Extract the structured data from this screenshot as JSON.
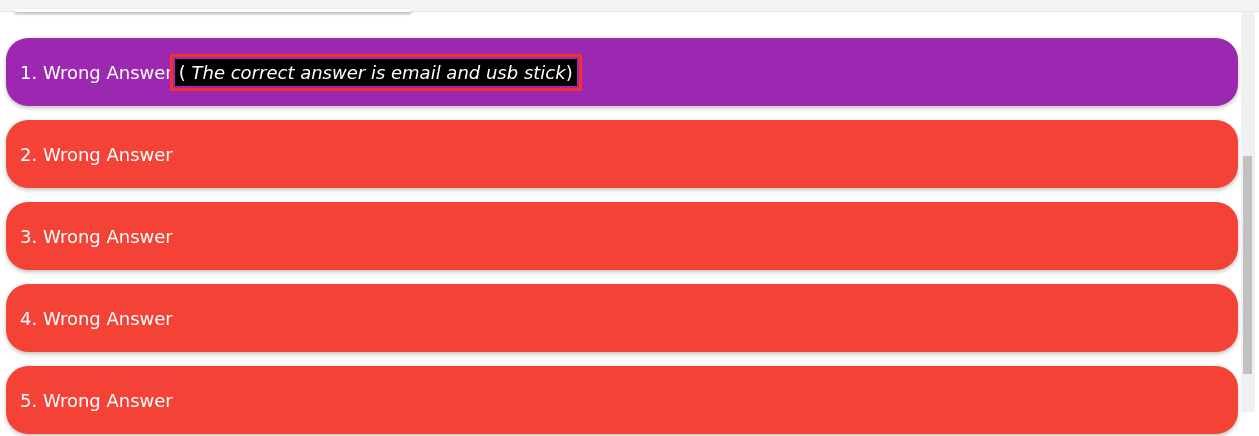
{
  "answers": [
    {
      "label": "1. Wrong Answer",
      "selected": true,
      "note": "( *The correct answer is email and usb stick*)"
    },
    {
      "label": "2. Wrong Answer",
      "selected": false
    },
    {
      "label": "3. Wrong Answer",
      "selected": false
    },
    {
      "label": "4. Wrong Answer",
      "selected": false
    },
    {
      "label": "5. Wrong Answer",
      "selected": false
    }
  ]
}
